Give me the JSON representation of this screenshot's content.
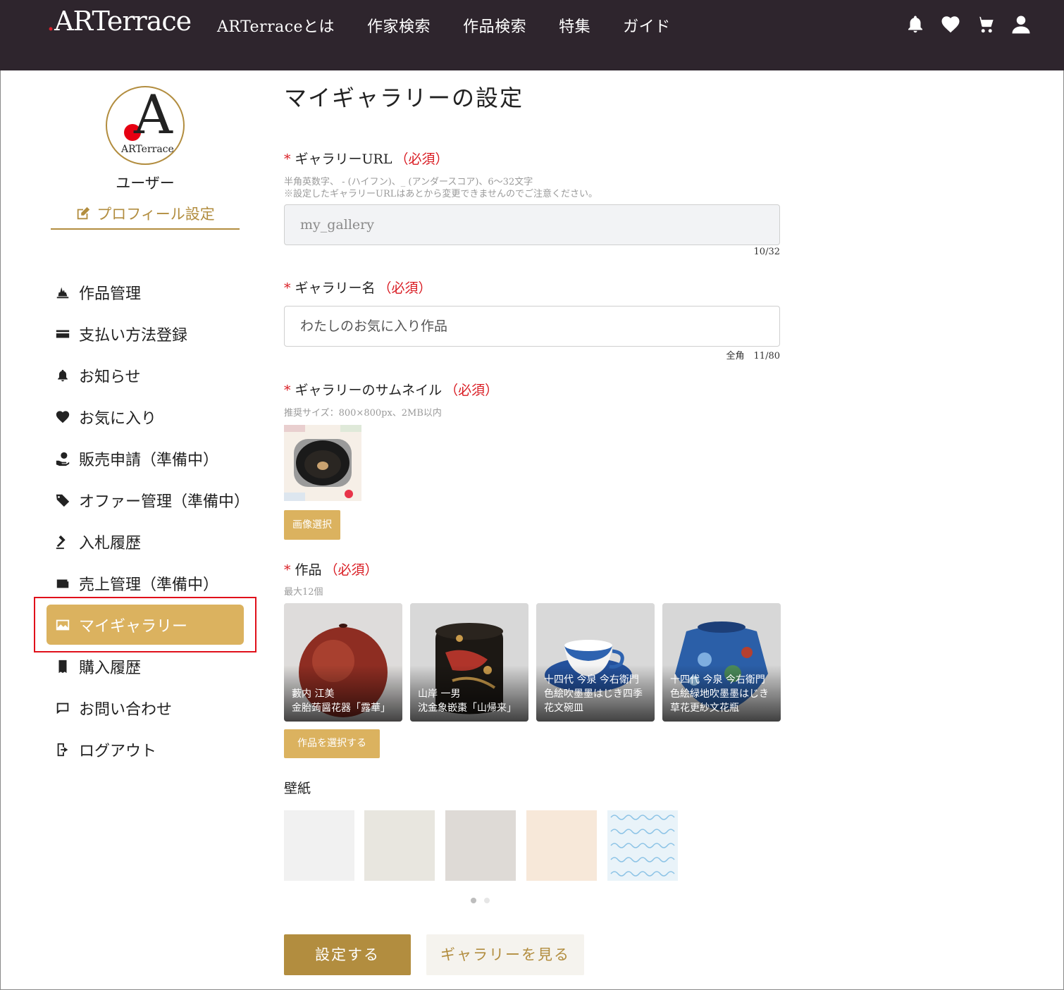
{
  "header": {
    "logo_text": "ARTerrace",
    "nav": [
      "ARTerraceとは",
      "作家検索",
      "作品検索",
      "特集",
      "ガイド"
    ],
    "icons": [
      "bell-icon",
      "heart-icon",
      "cart-icon",
      "user-icon"
    ]
  },
  "sidebar": {
    "avatar_text": "ARTerrace",
    "username": "ユーザー",
    "profile_link": "プロフィール設定",
    "items": [
      {
        "label": "作品管理",
        "icon": "artwork-icon"
      },
      {
        "label": "支払い方法登録",
        "icon": "credit-card-icon"
      },
      {
        "label": "お知らせ",
        "icon": "bell-icon"
      },
      {
        "label": "お気に入り",
        "icon": "heart-icon"
      },
      {
        "label": "販売申請（準備中）",
        "icon": "hand-money-icon"
      },
      {
        "label": "オファー管理（準備中）",
        "icon": "tag-icon"
      },
      {
        "label": "入札履歴",
        "icon": "gavel-icon"
      },
      {
        "label": "売上管理（準備中）",
        "icon": "wallet-icon"
      },
      {
        "label": "マイギャラリー",
        "icon": "gallery-image-icon",
        "active": true
      },
      {
        "label": "購入履歴",
        "icon": "receipt-icon"
      },
      {
        "label": "お問い合わせ",
        "icon": "chat-icon"
      },
      {
        "label": "ログアウト",
        "icon": "logout-icon"
      }
    ]
  },
  "main": {
    "title": "マイギャラリーの設定",
    "required_mark": "*",
    "required_text": "（必須）",
    "url_field": {
      "label": "ギャラリーURL",
      "hint1": "半角英数字、 - (ハイフン)、_ (アンダースコア)、6〜32文字",
      "hint2": "※設定したギャラリーURLはあとから変更できませんのでご注意ください。",
      "value": "my_gallery",
      "counter": "10/32"
    },
    "name_field": {
      "label": "ギャラリー名",
      "value": "わたしのお気に入り作品",
      "counter": "全角　11/80"
    },
    "thumbnail": {
      "label": "ギャラリーのサムネイル",
      "hint": "推奨サイズ：800×800px、2MB以内",
      "button": "画像選択"
    },
    "works": {
      "label": "作品",
      "hint": "最大12個",
      "items": [
        {
          "artist": "藪内 江美",
          "title": "金胎蒟醤花器「露華」"
        },
        {
          "artist": "山岸 一男",
          "title": "沈金象嵌棗「山帰来」"
        },
        {
          "artist": "十四代 今泉 今右衛門",
          "title": "色絵吹墨墨はじき四季花文碗皿"
        },
        {
          "artist": "十四代 今泉 今右衛門",
          "title": "色絵緑地吹墨墨はじき草花更紗文花瓶"
        }
      ],
      "button": "作品を選択する"
    },
    "wallpaper": {
      "label": "壁紙",
      "colors": [
        "#f1f1f1",
        "#e8e6df",
        "#dedad6",
        "#f7e8d9",
        "#e9f3f9"
      ]
    },
    "submit_button": "設定する",
    "view_button": "ギャラリーを見る"
  }
}
